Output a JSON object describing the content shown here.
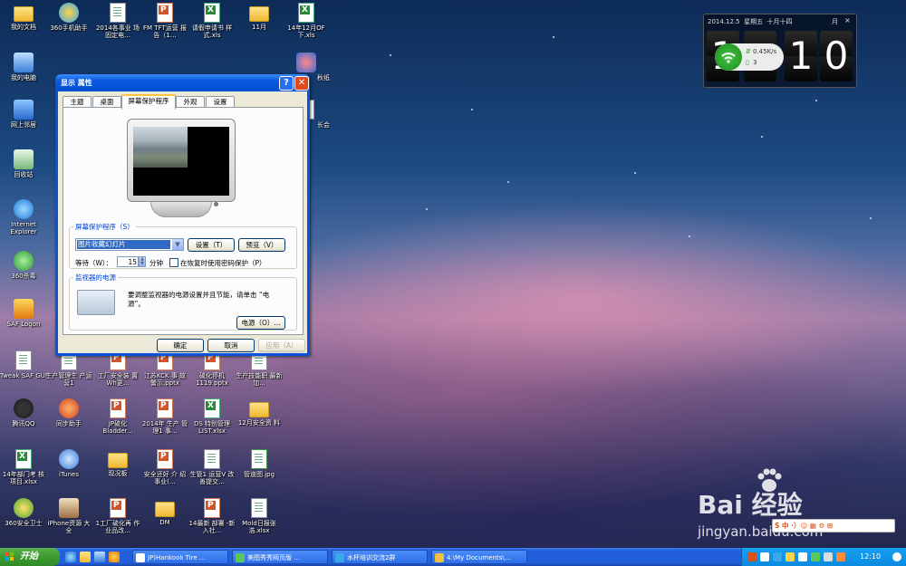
{
  "desktop": {
    "icons": [
      {
        "label": "我的文档",
        "type": "folder-doc"
      },
      {
        "label": "360手机助手",
        "type": "app"
      },
      {
        "label": "2014各事业 场固定电...",
        "type": "doc"
      },
      {
        "label": "FM TFT运营 报告（1...",
        "type": "ppt"
      },
      {
        "label": "请假申请书 样式.xls",
        "type": "xls"
      },
      {
        "label": "11月",
        "type": "folder"
      },
      {
        "label": "14年12月OF 下.xls",
        "type": "xls"
      },
      {
        "label": "我的电脑",
        "type": "app"
      },
      {
        "label": "秋纸",
        "type": "app"
      },
      {
        "label": "网上邻居",
        "type": "app"
      },
      {
        "label": "长会",
        "type": "doc"
      },
      {
        "label": "回收站",
        "type": "app"
      },
      {
        "label": "Internet Explorer",
        "type": "app"
      },
      {
        "label": "360杀毒",
        "type": "app"
      },
      {
        "label": "SAF Logon",
        "type": "app"
      },
      {
        "label": "Tweak SAF GUI",
        "type": "app"
      },
      {
        "label": "生产管理生 产运营1",
        "type": "doc"
      },
      {
        "label": "工厂安全装 置Wh更...",
        "type": "ppt"
      },
      {
        "label": "江苏KCK 事 故警示.pptx",
        "type": "ppt"
      },
      {
        "label": "硫化停机 1119.pptx",
        "type": "ppt"
      },
      {
        "label": "生产技能职 最新加...",
        "type": "doc"
      },
      {
        "label": "腾讯QQ",
        "type": "app"
      },
      {
        "label": "同步助手",
        "type": "app"
      },
      {
        "label": "JP硫化 Bladder...",
        "type": "ppt"
      },
      {
        "label": "2014年 生产 管理1 事...",
        "type": "ppt"
      },
      {
        "label": "DS 特别管理 LIST.xlsx",
        "type": "xls"
      },
      {
        "label": "12月安全资 料",
        "type": "folder"
      },
      {
        "label": "14年部门考 核项目.xlsx",
        "type": "xls"
      },
      {
        "label": "iTunes",
        "type": "app"
      },
      {
        "label": "现况板",
        "type": "folder"
      },
      {
        "label": "安全还好 介 绍 事业(...",
        "type": "ppt"
      },
      {
        "label": "生管1 运营V 改善提交...",
        "type": "doc"
      },
      {
        "label": "管道图.jpg",
        "type": "doc"
      },
      {
        "label": "360安全卫士",
        "type": "app"
      },
      {
        "label": "iPhone资源 大全",
        "type": "app"
      },
      {
        "label": "1工厂硫化再 作业品改...",
        "type": "ppt"
      },
      {
        "label": "DM",
        "type": "folder"
      },
      {
        "label": "14最新 部署 -新入社...",
        "type": "ppt"
      },
      {
        "label": "Mold日报张 浩.xlsx",
        "type": "doc"
      }
    ]
  },
  "clock_widget": {
    "date": "2014.12.5",
    "weekday": "星期五",
    "lunar": "十月十四",
    "month_label": "月",
    "hour_digit": "1",
    "minute_tens": "1",
    "minute_ones": "0",
    "net_speed": "0.45K/s",
    "net_count": "3"
  },
  "dialog": {
    "title": "显示 属性",
    "help": "?",
    "close": "✕",
    "tabs": [
      "主题",
      "桌面",
      "屏幕保护程序",
      "外观",
      "设置"
    ],
    "screensaver_group": "屏幕保护程序（S）",
    "screensaver_value": "图片收藏幻灯片",
    "settings_btn": "设置（T）",
    "preview_btn": "预览（V）",
    "wait_label": "等待（W）：",
    "wait_value": "15",
    "wait_unit": "分钟",
    "password_label": "在恢复时使用密码保护（P）",
    "power_group": "监视器的电源",
    "power_text_1": "要调整监视器的电源设置并且节能，请单击 “电",
    "power_text_2": "源”。",
    "power_btn": "电源（O）...",
    "ok_btn": "确定",
    "cancel_btn": "取消",
    "apply_btn": "应用（A）"
  },
  "taskbar": {
    "start_label": "开始",
    "tasks": [
      "JP)Hankook Tire ...",
      "美图秀秀网页版 ...",
      "水杯培训交流2群",
      "4.\\My Documents\\..."
    ],
    "time": "12:10"
  },
  "ime": {
    "text": "S 中 ·）☺ ▦ ⚙ ⊞"
  },
  "watermark": {
    "text": "Bai 经验",
    "url": "jingyan.baidu.com"
  }
}
